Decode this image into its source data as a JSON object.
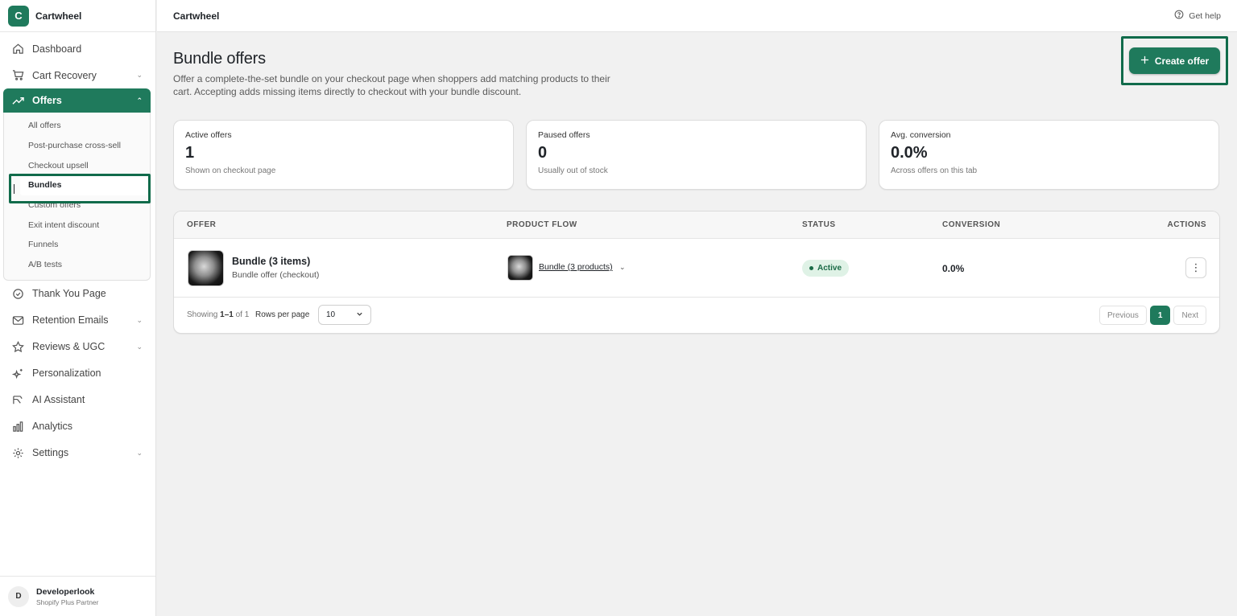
{
  "brand": {
    "logo_letter": "C",
    "name": "Cartwheel"
  },
  "nav": {
    "items": [
      {
        "label": "Dashboard",
        "icon": "home-icon"
      },
      {
        "label": "Cart Recovery",
        "icon": "cart-icon"
      },
      {
        "label": "Offers",
        "icon": "trending-up-icon"
      },
      {
        "label": "Thank You Page",
        "icon": "check-circle-icon"
      },
      {
        "label": "Retention Emails",
        "icon": "mail-icon"
      },
      {
        "label": "Reviews & UGC",
        "icon": "star-icon"
      },
      {
        "label": "Personalization",
        "icon": "sparkle-icon"
      },
      {
        "label": "AI Assistant",
        "icon": "robot-icon"
      },
      {
        "label": "Analytics",
        "icon": "bar-chart-icon"
      },
      {
        "label": "Settings",
        "icon": "gear-icon"
      }
    ],
    "offers_sub": [
      "All offers",
      "Post-purchase cross-sell",
      "Checkout upsell",
      "Bundles",
      "Custom offers",
      "Exit intent discount",
      "Funnels",
      "A/B tests"
    ]
  },
  "user": {
    "initial": "D",
    "name": "Developerlook",
    "role": "Shopify Plus Partner"
  },
  "topbar": {
    "title": "Cartwheel",
    "help": "Get help"
  },
  "page": {
    "title": "Bundle offers",
    "description": "Offer a complete-the-set bundle on your checkout page when shoppers add matching products to their cart. Accepting adds missing items directly to checkout with your bundle discount.",
    "create_label": "Create offer"
  },
  "stats": [
    {
      "label": "Active offers",
      "value": "1",
      "sub": "Shown on checkout page"
    },
    {
      "label": "Paused offers",
      "value": "0",
      "sub": "Usually out of stock"
    },
    {
      "label": "Avg. conversion",
      "value": "0.0%",
      "sub": "Across offers on this tab"
    }
  ],
  "table": {
    "headers": {
      "offer": "OFFER",
      "flow": "PRODUCT FLOW",
      "status": "STATUS",
      "conversion": "CONVERSION",
      "actions": "ACTIONS"
    },
    "rows": [
      {
        "name": "Bundle (3 items)",
        "sub": "Bundle offer (checkout)",
        "flow": "Bundle (3 products)",
        "status": "Active",
        "conversion": "0.0%"
      }
    ],
    "footer": {
      "showing_prefix": "Showing ",
      "showing_range": "1–1",
      "showing_suffix": " of 1",
      "rows_label": "Rows per page",
      "rows_value": "10",
      "prev": "Previous",
      "page": "1",
      "next": "Next"
    }
  },
  "colors": {
    "accent": "#1f7a5c",
    "highlight": "#116b4b",
    "active_badge_bg": "#dff2e6"
  }
}
